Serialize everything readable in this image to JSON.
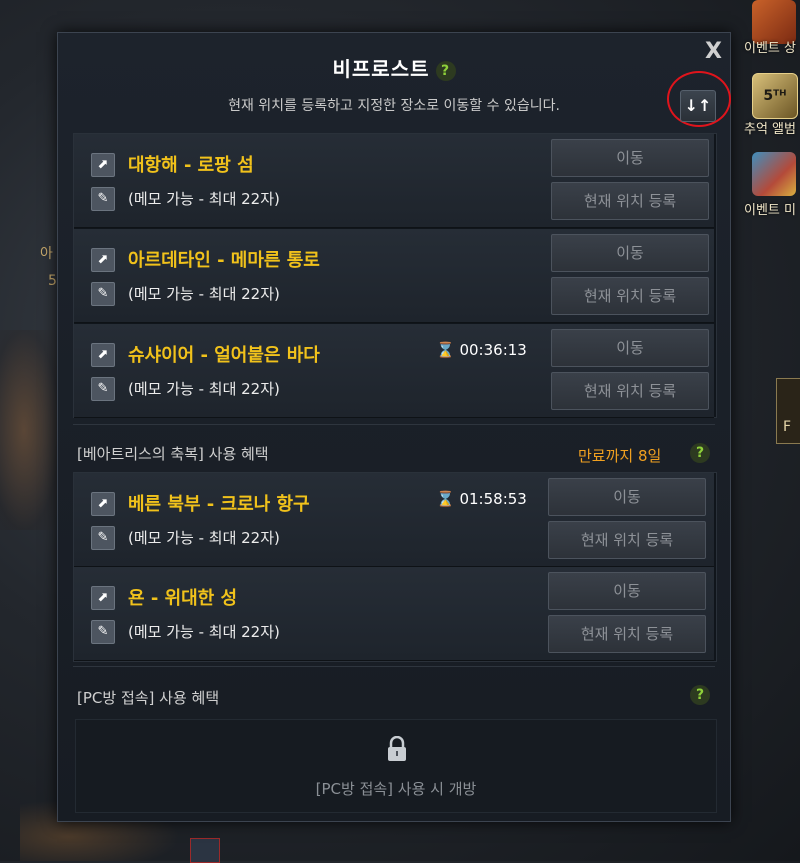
{
  "panel": {
    "title": "비프로스트",
    "subtitle": "현재 위치를 등록하고 지정한 장소로 이동할 수 있습니다.",
    "close_label": "X",
    "sort_label": "↓↑",
    "help_label": "?"
  },
  "slots_basic": [
    {
      "name": "대항해 - 로팡 섬",
      "memo": "(메모 가능 - 최대 22자)",
      "timer": "",
      "move": "이동",
      "register": "현재 위치 등록"
    },
    {
      "name": "아르데타인 - 메마른 통로",
      "memo": "(메모 가능 - 최대 22자)",
      "timer": "",
      "move": "이동",
      "register": "현재 위치 등록"
    },
    {
      "name": "슈샤이어 - 얼어붙은 바다",
      "memo": "(메모 가능 - 최대 22자)",
      "timer": "00:36:13",
      "move": "이동",
      "register": "현재 위치 등록"
    }
  ],
  "blessing": {
    "label": "[베아트리스의 축복] 사용 혜택",
    "expire": "만료까지 8일",
    "slots": [
      {
        "name": "베른 북부 - 크로나 항구",
        "memo": "(메모 가능 - 최대 22자)",
        "timer": "01:58:53",
        "move": "이동",
        "register": "현재 위치 등록"
      },
      {
        "name": "욘 - 위대한 성",
        "memo": "(메모 가능 - 최대 22자)",
        "timer": "",
        "move": "이동",
        "register": "현재 위치 등록"
      }
    ]
  },
  "pcbang": {
    "label": "[PC방 접속] 사용 혜택",
    "locked_text": "[PC방 접속] 사용 시 개방"
  },
  "side_events": [
    {
      "label": "이벤트 상",
      "icon": "event-shop-icon"
    },
    {
      "label": "추억 앨범",
      "icon": "album-icon"
    },
    {
      "label": "이벤트 미",
      "icon": "gift-icon"
    }
  ],
  "bg_text": {
    "left1": "아",
    "left2": "5",
    "right": "F"
  },
  "colors": {
    "accent": "#f1c21b",
    "expire": "#f0a020",
    "help": "#8ed03a",
    "highlight_circle": "#e0141c"
  }
}
